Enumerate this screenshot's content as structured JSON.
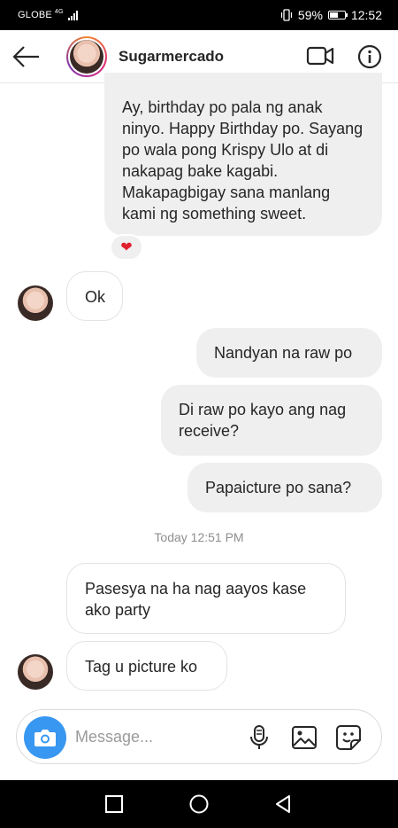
{
  "status": {
    "carrier": "GLOBE",
    "network": "4G",
    "battery": "59%",
    "battery_level": 0.59,
    "time": "12:52"
  },
  "header": {
    "title": "Sugarmercado"
  },
  "messages": {
    "m1": "Ay, birthday po pala ng anak ninyo. Happy Birthday po. Sayang po wala pong Krispy Ulo at di nakapag bake kagabi. Makapagbigay sana manlang kami ng something sweet.",
    "m1_reaction": "❤",
    "m2": "Ok",
    "m3": "Nandyan na raw po",
    "m4": "Di raw po kayo ang nag receive?",
    "m5": "Papaicture po sana?",
    "timestamp": "Today 12:51 PM",
    "m6": "Pasesya na ha nag aayos kase ako party",
    "m7": "Tag u picture ko"
  },
  "composer": {
    "placeholder": "Message..."
  },
  "colors": {
    "accent": "#3897f0",
    "outgoing_bubble": "#efefef",
    "heart": "#e0202f"
  }
}
